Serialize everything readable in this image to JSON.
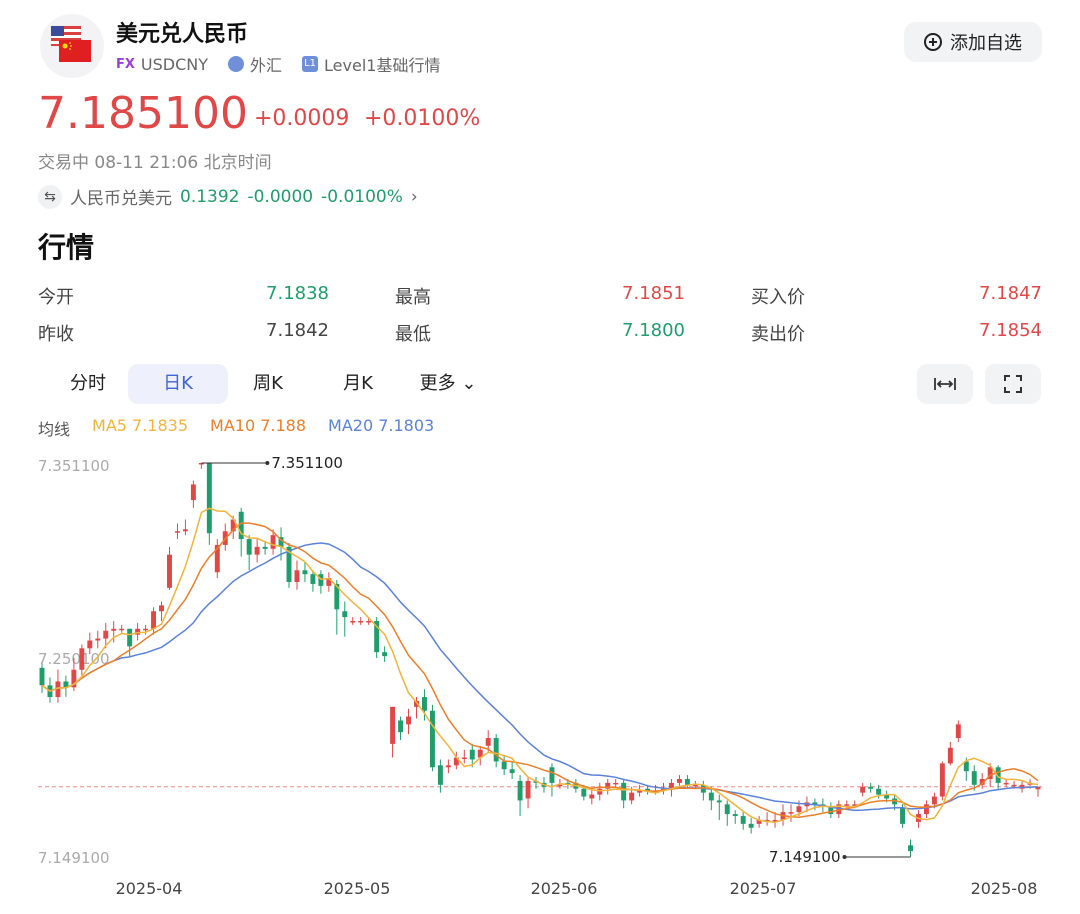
{
  "header": {
    "title": "美元兑人民币",
    "badge_fx": "FX",
    "symbol": "USDCNY",
    "market": "外汇",
    "level_badge": "L1",
    "level": "Level1基础行情",
    "add_button": "添加自选"
  },
  "quote": {
    "price": "7.185100",
    "change": "+0.0009",
    "change_pct": "+0.0100%",
    "status": "交易中 08-11 21:06 北京时间",
    "inverse_label": "人民币兑美元",
    "inverse_price": "0.1392",
    "inverse_change": "-0.0000",
    "inverse_pct": "-0.0100%"
  },
  "section_title": "行情",
  "stats": [
    {
      "label": "今开",
      "value": "7.1838",
      "color": "#1f9e6b"
    },
    {
      "label": "最高",
      "value": "7.1851",
      "color": "#e04848"
    },
    {
      "label": "买入价",
      "value": "7.1847",
      "color": "#e04848"
    },
    {
      "label": "昨收",
      "value": "7.1842",
      "color": "#444444"
    },
    {
      "label": "最低",
      "value": "7.1800",
      "color": "#1f9e6b"
    },
    {
      "label": "卖出价",
      "value": "7.1854",
      "color": "#e04848"
    }
  ],
  "tabs": [
    {
      "label": "分时",
      "active": false
    },
    {
      "label": "日K",
      "active": true
    },
    {
      "label": "周K",
      "active": false
    },
    {
      "label": "月K",
      "active": false
    },
    {
      "label": "更多",
      "active": false
    }
  ],
  "toolbar_icons": [
    "fit-width-icon",
    "fullscreen-icon"
  ],
  "ma_legend": {
    "label": "均线",
    "ma5": "MA5 7.1835",
    "ma10": "MA10 7.188",
    "ma20": "MA20 7.1803"
  },
  "colors": {
    "up": "#e04848",
    "down": "#1f9e6b",
    "ma5": "#f2b43a",
    "ma10": "#ec7f2a",
    "ma20": "#5b82d9",
    "accent": "#3e64d6"
  },
  "chart_data": {
    "type": "candlestick",
    "ylim": [
      7.1491,
      7.3511
    ],
    "y_ticks": [
      "7.351100",
      "7.250100",
      "7.149100"
    ],
    "x_ticks": [
      "2025-04",
      "2025-05",
      "2025-06",
      "2025-07",
      "2025-08"
    ],
    "max_label": "7.351100",
    "min_label": "7.149100",
    "last_price": 7.1851,
    "candles": [
      [
        7.2461,
        7.2371,
        7.2482,
        7.2332
      ],
      [
        7.2371,
        7.2311,
        7.2412,
        7.2282
      ],
      [
        7.2311,
        7.2391,
        7.2452,
        7.2282
      ],
      [
        7.2391,
        7.2361,
        7.2421,
        7.2312
      ],
      [
        7.2361,
        7.2451,
        7.2511,
        7.2342
      ],
      [
        7.2451,
        7.2561,
        7.2581,
        7.2422
      ],
      [
        7.2561,
        7.2601,
        7.2641,
        7.2532
      ],
      [
        7.2601,
        7.2611,
        7.2651,
        7.2561
      ],
      [
        7.2611,
        7.2651,
        7.2691,
        7.2561
      ],
      [
        7.2651,
        7.2661,
        7.2701,
        7.2591
      ],
      [
        7.2661,
        7.2661,
        7.2681,
        7.2641
      ],
      [
        7.2661,
        7.2571,
        7.2661,
        7.2521
      ],
      [
        7.2631,
        7.2661,
        7.2691,
        7.2601
      ],
      [
        7.2661,
        7.2661,
        7.2681,
        7.2631
      ],
      [
        7.2661,
        7.2751,
        7.2771,
        7.2631
      ],
      [
        7.2751,
        7.2781,
        7.2801,
        7.2701
      ],
      [
        7.2871,
        7.3041,
        7.3081,
        7.2861
      ],
      [
        7.3161,
        7.3161,
        7.3201,
        7.3121
      ],
      [
        7.3161,
        7.3171,
        7.3221,
        7.3141
      ],
      [
        7.3321,
        7.3401,
        7.3421,
        7.3281
      ],
      [
        7.3511,
        7.3511,
        7.3511,
        7.3481
      ],
      [
        7.3511,
        7.3151,
        7.3511,
        7.3091
      ],
      [
        7.2951,
        7.3091,
        7.3121,
        7.2921
      ],
      [
        7.3091,
        7.3161,
        7.3201,
        7.3061
      ],
      [
        7.3161,
        7.3221,
        7.3241,
        7.3121
      ],
      [
        7.3261,
        7.3121,
        7.3281,
        7.3031
      ],
      [
        7.3121,
        7.3041,
        7.3141,
        7.2961
      ],
      [
        7.3041,
        7.3081,
        7.3121,
        7.3001
      ],
      [
        7.3081,
        7.3071,
        7.3111,
        7.3041
      ],
      [
        7.3071,
        7.3141,
        7.3171,
        7.3041
      ],
      [
        7.3131,
        7.3081,
        7.3181,
        7.3011
      ],
      [
        7.3081,
        7.2901,
        7.3101,
        7.2871
      ],
      [
        7.2901,
        7.2961,
        7.3011,
        7.2861
      ],
      [
        7.2961,
        7.2941,
        7.3001,
        7.2901
      ],
      [
        7.2941,
        7.2891,
        7.2961,
        7.2851
      ],
      [
        7.2941,
        7.2881,
        7.2961,
        7.2841
      ],
      [
        7.2881,
        7.2921,
        7.2951,
        7.2851
      ],
      [
        7.2891,
        7.2761,
        7.2911,
        7.2631
      ],
      [
        7.2751,
        7.2721,
        7.2801,
        7.2621
      ],
      [
        7.2701,
        7.2701,
        7.2721,
        7.2681
      ],
      [
        7.2701,
        7.2701,
        7.2721,
        7.2681
      ],
      [
        7.2701,
        7.2701,
        7.2721,
        7.2681
      ],
      [
        7.2701,
        7.2541,
        7.2721,
        7.2511
      ],
      [
        7.2541,
        7.2521,
        7.2571,
        7.2491
      ],
      [
        7.2071,
        7.2261,
        7.2261,
        7.2001
      ],
      [
        7.2191,
        7.2131,
        7.2211,
        7.2091
      ],
      [
        7.2171,
        7.2211,
        7.2251,
        7.2121
      ],
      [
        7.2261,
        7.2291,
        7.2311,
        7.2201
      ],
      [
        7.2311,
        7.2241,
        7.2351,
        7.2191
      ],
      [
        7.2241,
        7.1951,
        7.2271,
        7.1931
      ],
      [
        7.1961,
        7.1861,
        7.1991,
        7.1821
      ],
      [
        7.1951,
        7.1961,
        7.1991,
        7.1921
      ],
      [
        7.1961,
        7.2001,
        7.2031,
        7.1941
      ],
      [
        7.2001,
        7.2001,
        7.2041,
        7.1971
      ],
      [
        7.2041,
        7.1991,
        7.2071,
        7.1951
      ],
      [
        7.2001,
        7.2041,
        7.2061,
        7.1961
      ],
      [
        7.2061,
        7.2101,
        7.2141,
        7.2031
      ],
      [
        7.2101,
        7.1981,
        7.2121,
        7.1951
      ],
      [
        7.1981,
        7.1941,
        7.2011,
        7.1911
      ],
      [
        7.1941,
        7.1921,
        7.1981,
        7.1891
      ],
      [
        7.1881,
        7.1781,
        7.1911,
        7.1701
      ],
      [
        7.1791,
        7.1881,
        7.1901,
        7.1741
      ],
      [
        7.1881,
        7.1871,
        7.1901,
        7.1841
      ],
      [
        7.1871,
        7.1851,
        7.1901,
        7.1821
      ],
      [
        7.1951,
        7.1871,
        7.1971,
        7.1801
      ],
      [
        7.1861,
        7.1861,
        7.1891,
        7.1841
      ],
      [
        7.1871,
        7.1861,
        7.1891,
        7.1841
      ],
      [
        7.1871,
        7.1841,
        7.1891,
        7.1821
      ],
      [
        7.1841,
        7.1801,
        7.1861,
        7.1781
      ],
      [
        7.1791,
        7.1811,
        7.1841,
        7.1761
      ],
      [
        7.1811,
        7.1841,
        7.1871,
        7.1781
      ],
      [
        7.1841,
        7.1871,
        7.1891,
        7.1811
      ],
      [
        7.1871,
        7.1871,
        7.1891,
        7.1851
      ],
      [
        7.1871,
        7.1781,
        7.1891,
        7.1741
      ],
      [
        7.1781,
        7.1821,
        7.1851,
        7.1761
      ],
      [
        7.1821,
        7.1831,
        7.1861,
        7.1801
      ],
      [
        7.1841,
        7.1831,
        7.1861,
        7.1811
      ],
      [
        7.1831,
        7.1831,
        7.1861,
        7.1811
      ],
      [
        7.1831,
        7.1841,
        7.1871,
        7.1811
      ],
      [
        7.1841,
        7.1871,
        7.1891,
        7.1801
      ],
      [
        7.1871,
        7.1891,
        7.1911,
        7.1851
      ],
      [
        7.1891,
        7.1861,
        7.1911,
        7.1841
      ],
      [
        7.1861,
        7.1861,
        7.1881,
        7.1841
      ],
      [
        7.1861,
        7.1821,
        7.1881,
        7.1781
      ],
      [
        7.1821,
        7.1781,
        7.1851,
        7.1731
      ],
      [
        7.1781,
        7.1771,
        7.1811,
        7.1681
      ],
      [
        7.1761,
        7.1711,
        7.1781,
        7.1651
      ],
      [
        7.1711,
        7.1701,
        7.1731,
        7.1661
      ],
      [
        7.1701,
        7.1661,
        7.1721,
        7.1631
      ],
      [
        7.1661,
        7.1641,
        7.1691,
        7.1611
      ],
      [
        7.1661,
        7.1681,
        7.1701,
        7.1641
      ],
      [
        7.1681,
        7.1681,
        7.1721,
        7.1651
      ],
      [
        7.1681,
        7.1681,
        7.1721,
        7.1641
      ],
      [
        7.1681,
        7.1721,
        7.1761,
        7.1651
      ],
      [
        7.1721,
        7.1721,
        7.1761,
        7.1671
      ],
      [
        7.1721,
        7.1751,
        7.1781,
        7.1701
      ],
      [
        7.1751,
        7.1771,
        7.1801,
        7.1721
      ],
      [
        7.1771,
        7.1761,
        7.1791,
        7.1731
      ],
      [
        7.1761,
        7.1751,
        7.1791,
        7.1721
      ],
      [
        7.1751,
        7.1711,
        7.1771,
        7.1691
      ],
      [
        7.1711,
        7.1761,
        7.1781,
        7.1691
      ],
      [
        7.1761,
        7.1761,
        7.1781,
        7.1741
      ],
      [
        7.1761,
        7.1761,
        7.1781,
        7.1741
      ],
      [
        7.1821,
        7.1851,
        7.1871,
        7.1801
      ],
      [
        7.1851,
        7.1841,
        7.1871,
        7.1821
      ],
      [
        7.1841,
        7.1811,
        7.1861,
        7.1791
      ],
      [
        7.1811,
        7.1791,
        7.1831,
        7.1771
      ],
      [
        7.1791,
        7.1761,
        7.1811,
        7.1731
      ],
      [
        7.1741,
        7.1661,
        7.1761,
        7.1641
      ],
      [
        7.1551,
        7.1521,
        7.1581,
        7.1491
      ],
      [
        7.1671,
        7.1711,
        7.1731,
        7.1641
      ],
      [
        7.1711,
        7.1761,
        7.1781,
        7.1691
      ],
      [
        7.1761,
        7.1801,
        7.1821,
        7.1741
      ],
      [
        7.1801,
        7.1971,
        7.1981,
        7.1781
      ],
      [
        7.1971,
        7.2051,
        7.2081,
        7.1961
      ],
      [
        7.2101,
        7.2171,
        7.2191,
        7.2081
      ],
      [
        7.1981,
        7.1931,
        7.2001,
        7.1881
      ],
      [
        7.1931,
        7.1861,
        7.1961,
        7.1831
      ],
      [
        7.1861,
        7.1891,
        7.1921,
        7.1841
      ],
      [
        7.1891,
        7.1951,
        7.1971,
        7.1851
      ],
      [
        7.1951,
        7.1871,
        7.1961,
        7.1841
      ],
      [
        7.1871,
        7.1871,
        7.1891,
        7.1851
      ],
      [
        7.1861,
        7.1861,
        7.1881,
        7.1841
      ],
      [
        7.1841,
        7.1861,
        7.1881,
        7.1821
      ],
      [
        7.1861,
        7.1871,
        7.1891,
        7.1841
      ],
      [
        7.1838,
        7.1851,
        7.1851,
        7.18
      ]
    ]
  }
}
